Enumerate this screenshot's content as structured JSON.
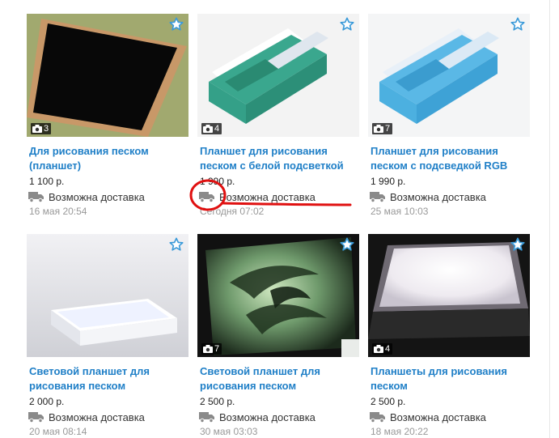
{
  "listings": [
    {
      "title": "Для рисования песком (планшет)",
      "price": "1 100 р.",
      "delivery": "Возможна доставка",
      "date": "16 мая 20:54",
      "photos": "3"
    },
    {
      "title": "Планшет для рисования песком с белой подсветкой",
      "price": "1 990 р.",
      "delivery": "Возможна доставка",
      "date": "Сегодня 07:02",
      "photos": "4"
    },
    {
      "title": "Планшет для рисования песком с подсведкой RGB",
      "price": "1 990 р.",
      "delivery": "Возможна доставка",
      "date": "25 мая 10:03",
      "photos": "7"
    },
    {
      "title": "Световой планшет для рисования песком",
      "price": "2 000 р.",
      "delivery": "Возможна доставка",
      "date": "20 мая 08:14",
      "photos": ""
    },
    {
      "title": "Световой планшет для рисования песком",
      "price": "2 500 р.",
      "delivery": "Возможна доставка",
      "date": "30 мая 03:03",
      "photos": "7"
    },
    {
      "title": "Планшеты для рисования песком",
      "price": "2 500 р.",
      "delivery": "Возможна доставка",
      "date": "18 мая 20:22",
      "photos": "4"
    }
  ],
  "icons": {
    "favorite": "star-outline-icon",
    "photos": "camera-icon",
    "delivery": "truck-icon"
  },
  "colors": {
    "link": "#1f7fc7",
    "annotation": "#e01010",
    "star": "#3a9ad9"
  }
}
